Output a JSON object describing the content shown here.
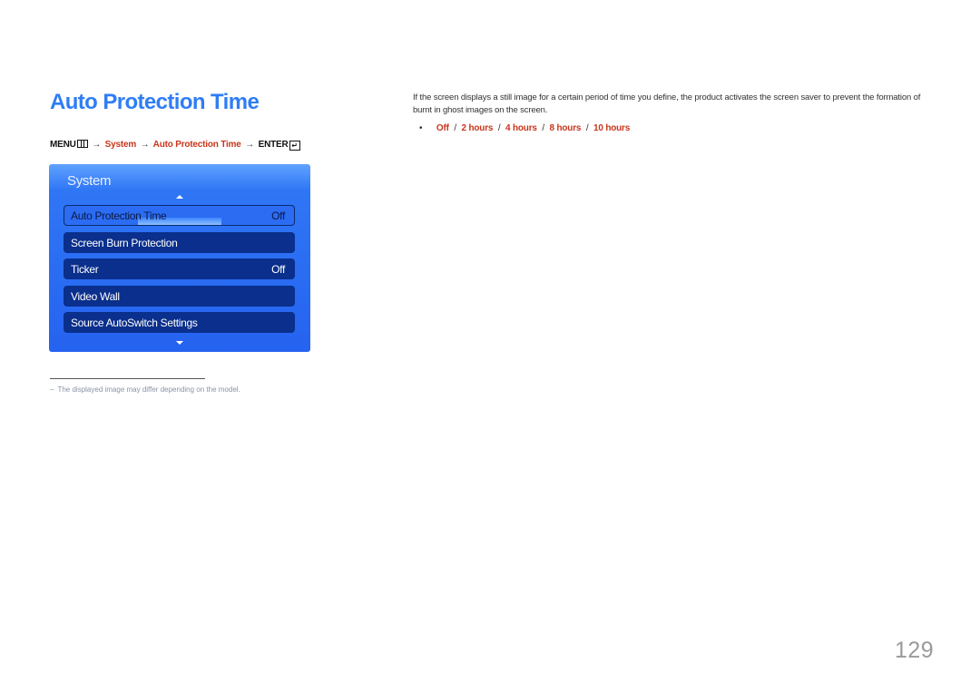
{
  "title": "Auto Protection Time",
  "menu_path": {
    "menu_label": "MENU",
    "menu_icon": "menu-icon",
    "arrow": "→",
    "steps": [
      "System",
      "Auto Protection Time"
    ],
    "enter_label": "ENTER",
    "enter_icon": "enter-icon",
    "enter_glyph": "↵"
  },
  "osd": {
    "title": "System",
    "items": [
      {
        "label": "Auto Protection Time",
        "value": "Off",
        "selected": true
      },
      {
        "label": "Screen Burn Protection",
        "value": ""
      },
      {
        "label": "Ticker",
        "value": "Off"
      },
      {
        "label": "Video Wall",
        "value": ""
      },
      {
        "label": "Source AutoSwitch Settings",
        "value": ""
      }
    ]
  },
  "footnote": {
    "dash": "–",
    "text": "The displayed image may differ depending on the model."
  },
  "description": "If the screen displays a still image for a certain period of time you define, the product activates the screen saver to prevent the formation of burnt in ghost images on the screen.",
  "options": {
    "bullet": "•",
    "separator": "/",
    "values": [
      "Off",
      "2 hours",
      "4 hours",
      "8 hours",
      "10 hours"
    ]
  },
  "page_number": "129",
  "colors": {
    "title_blue": "#2f7df6",
    "accent_red": "#c8361c",
    "osd_panel": "#2563f0",
    "osd_item": "#0a2f8c"
  }
}
